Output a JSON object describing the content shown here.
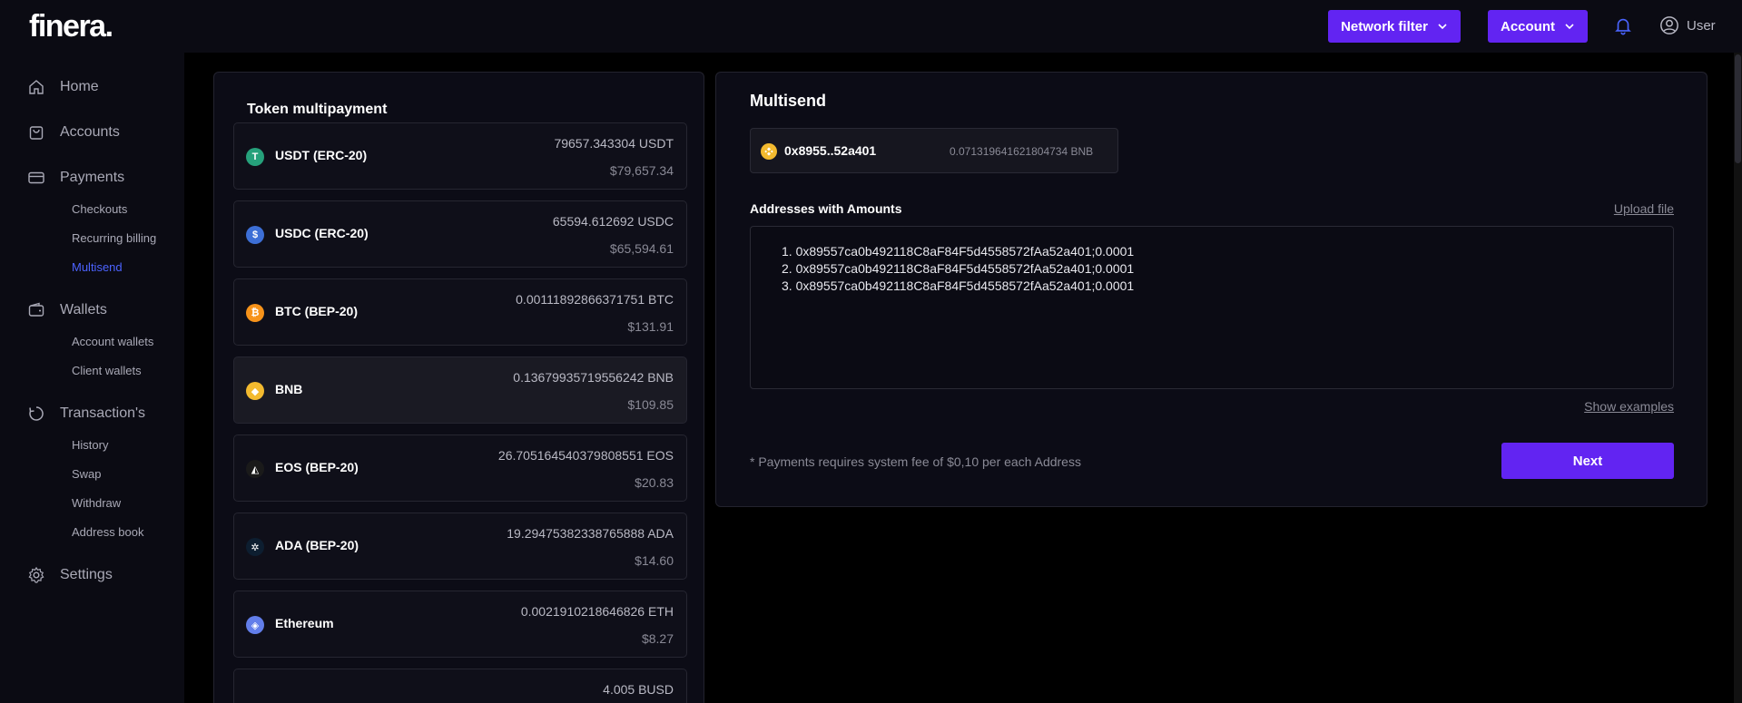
{
  "app": {
    "logo": "finera",
    "logo_dot": "."
  },
  "topbar": {
    "network_filter": "Network filter",
    "account": "Account",
    "user": "User"
  },
  "sidebar": {
    "home": "Home",
    "accounts": "Accounts",
    "payments": "Payments",
    "checkouts": "Checkouts",
    "recurring": "Recurring billing",
    "multisend": "Multisend",
    "wallets": "Wallets",
    "account_wallets": "Account wallets",
    "client_wallets": "Client wallets",
    "transactions": "Transaction's",
    "history": "History",
    "swap": "Swap",
    "withdraw": "Withdraw",
    "address_book": "Address book",
    "settings": "Settings"
  },
  "tokens": {
    "title": "Token multipayment",
    "items": [
      {
        "name": "USDT (ERC-20)",
        "amount": "79657.343304 USDT",
        "usd": "$79,657.34",
        "icon": "usdt-icon",
        "color": "#26a17b",
        "glyph": "T"
      },
      {
        "name": "USDC (ERC-20)",
        "amount": "65594.612692 USDC",
        "usd": "$65,594.61",
        "icon": "usdc-icon",
        "color": "#3d6fd6",
        "glyph": "$"
      },
      {
        "name": "BTC (BEP-20)",
        "amount": "0.00111892866371751 BTC",
        "usd": "$131.91",
        "icon": "btc-icon",
        "color": "#f7931a",
        "glyph": "₿"
      },
      {
        "name": "BNB",
        "amount": "0.13679935719556242 BNB",
        "usd": "$109.85",
        "icon": "bnb-icon",
        "color": "#f3ba2f",
        "glyph": "◆"
      },
      {
        "name": "EOS (BEP-20)",
        "amount": "26.705164540379808551 EOS",
        "usd": "$20.83",
        "icon": "eos-icon",
        "color": "#1a1a1a",
        "glyph": "◭"
      },
      {
        "name": "ADA (BEP-20)",
        "amount": "19.29475382338765888 ADA",
        "usd": "$14.60",
        "icon": "ada-icon",
        "color": "#0d1e30",
        "glyph": "✲"
      },
      {
        "name": "Ethereum",
        "amount": "0.0021910218646826 ETH",
        "usd": "$8.27",
        "icon": "eth-icon",
        "color": "#627eea",
        "glyph": "◈"
      },
      {
        "name": "",
        "amount": "4.005 BUSD",
        "usd": "",
        "icon": "busd-icon",
        "color": "#f3ba2f",
        "glyph": ""
      }
    ]
  },
  "multisend": {
    "title": "Multisend",
    "wallet_address": "0x8955..52a401",
    "wallet_balance": "0.071319641621804734 BNB",
    "addresses_label": "Addresses with Amounts",
    "upload_file": "Upload file",
    "lines": [
      "1. 0x89557ca0b492118C8aF84F5d4558572fAa52a401;0.0001",
      "2. 0x89557ca0b492118C8aF84F5d4558572fAa52a401;0.0001",
      "3. 0x89557ca0b492118C8aF84F5d4558572fAa52a401;0.0001"
    ],
    "show_examples": "Show examples",
    "fee_note": "* Payments requires system fee of $0,10 per each Address",
    "next": "Next"
  }
}
